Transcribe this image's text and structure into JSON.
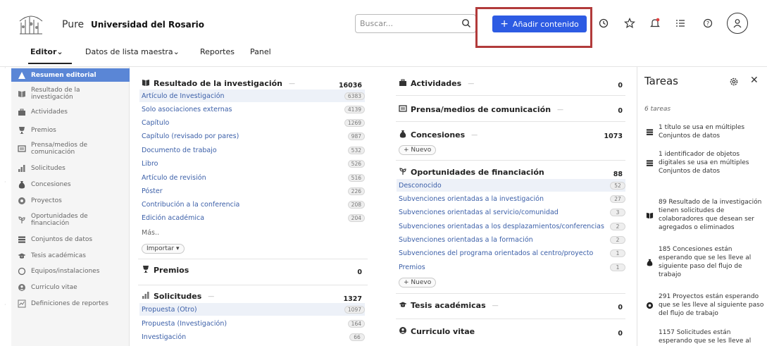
{
  "header": {
    "brand": "Pure",
    "organization": "Universidad del Rosario",
    "search_placeholder": "Buscar...",
    "add_button": "Añadir contenido",
    "add_button_icon": "plus-icon",
    "icons": [
      "clock-icon",
      "star-icon",
      "bell-icon",
      "task-list-icon",
      "help-icon",
      "user-avatar-icon"
    ],
    "accent_color": "#2d5be3",
    "highlight_color": "#b23b3b"
  },
  "nav": {
    "editor": "Editor",
    "master_list": "Datos de lista maestra",
    "reports": "Reportes",
    "panel": "Panel"
  },
  "sidebar": {
    "items": [
      {
        "label": "Resumen editorial",
        "icon": "summary-icon"
      },
      {
        "label": "Resultado de la investigación",
        "icon": "book-icon"
      },
      {
        "label": "Actividades",
        "icon": "briefcase-icon"
      },
      {
        "label": "Premios",
        "icon": "trophy-icon"
      },
      {
        "label": "Prensa/medios de comunicación",
        "icon": "newspaper-icon"
      },
      {
        "label": "Solicitudes",
        "icon": "bar-chart-icon"
      },
      {
        "label": "Concesiones",
        "icon": "money-bag-icon"
      },
      {
        "label": "Proyectos",
        "icon": "projects-icon"
      },
      {
        "label": "Oportunidades de financiación",
        "icon": "sprout-icon"
      },
      {
        "label": "Conjuntos de datos",
        "icon": "dataset-icon"
      },
      {
        "label": "Tesis académicas",
        "icon": "graduation-cap-icon"
      },
      {
        "label": "Equipos/instalaciones",
        "icon": "equipment-icon"
      },
      {
        "label": "Curriculo vitae",
        "icon": "cv-icon"
      },
      {
        "label": "Definiciones de reportes",
        "icon": "report-icon"
      }
    ]
  },
  "research_output": {
    "title": "Resultado de la investigación",
    "count": "16036",
    "rows": [
      {
        "label": "Artículo de Investigación",
        "count": "6383"
      },
      {
        "label": "Solo asociaciones externas",
        "count": "4139"
      },
      {
        "label": "Capítulo",
        "count": "1269"
      },
      {
        "label": "Capítulo (revisado por pares)",
        "count": "987"
      },
      {
        "label": "Documento de trabajo",
        "count": "532"
      },
      {
        "label": "Libro",
        "count": "526"
      },
      {
        "label": "Artículo de revisión",
        "count": "516"
      },
      {
        "label": "Póster",
        "count": "226"
      },
      {
        "label": "Contribución a la conferencia",
        "count": "208"
      },
      {
        "label": "Edición académica",
        "count": "204"
      }
    ],
    "more": "Más..",
    "import": "Importar"
  },
  "awards": {
    "title": "Premios",
    "count": "0"
  },
  "applications": {
    "title": "Solicitudes",
    "count": "1327",
    "rows": [
      {
        "label": "Propuesta (Otro)",
        "count": "1097"
      },
      {
        "label": "Propuesta (Investigación)",
        "count": "164"
      },
      {
        "label": "Investigación",
        "count": "66"
      }
    ]
  },
  "activities": {
    "title": "Actividades",
    "count": "0"
  },
  "press": {
    "title": "Prensa/medios de comunicación",
    "count": "0"
  },
  "grants": {
    "title": "Concesiones",
    "count": "1073",
    "new": "+ Nuevo"
  },
  "funding": {
    "title": "Oportunidades de financiación",
    "count": "88",
    "rows": [
      {
        "label": "Desconocido",
        "count": "52"
      },
      {
        "label": "Subvenciones orientadas a la investigación",
        "count": "27"
      },
      {
        "label": "Subvenciones orientadas al servicio/comunidad",
        "count": "3"
      },
      {
        "label": "Subvenciones orientadas a los desplazamientos/conferencias",
        "count": "2"
      },
      {
        "label": "Subvenciones orientadas a la formación",
        "count": "2"
      },
      {
        "label": "Subvenciones del programa orientados al centro/proyecto",
        "count": "1"
      },
      {
        "label": "Premios",
        "count": "1"
      }
    ],
    "new": "+ Nuevo"
  },
  "theses": {
    "title": "Tesis académicas",
    "count": "0"
  },
  "cv": {
    "title": "Curriculo vitae",
    "count": "0"
  },
  "tasks": {
    "title": "Tareas",
    "count_text": "6 tareas",
    "items": [
      {
        "icon": "dataset-icon",
        "text": "1 título se usa en múltiples Conjuntos de datos"
      },
      {
        "icon": "dataset-icon",
        "text": "1 identificador de objetos digitales se usa en múltiples Conjuntos de datos"
      },
      {
        "icon": "book-icon",
        "text": "89 Resultado de la investigación tienen solicitudes de colaboradores que desean ser agregados o eliminados"
      },
      {
        "icon": "money-bag-icon",
        "text": "185 Concesiones están esperando que se les lleve al siguiente paso del flujo de trabajo"
      },
      {
        "icon": "projects-icon",
        "text": "291 Proyectos están esperando que se les lleve al siguiente paso del flujo de trabajo"
      },
      {
        "icon": "bar-chart-icon",
        "text": "1157 Solicitudes están esperando que se les lleve al"
      }
    ]
  }
}
